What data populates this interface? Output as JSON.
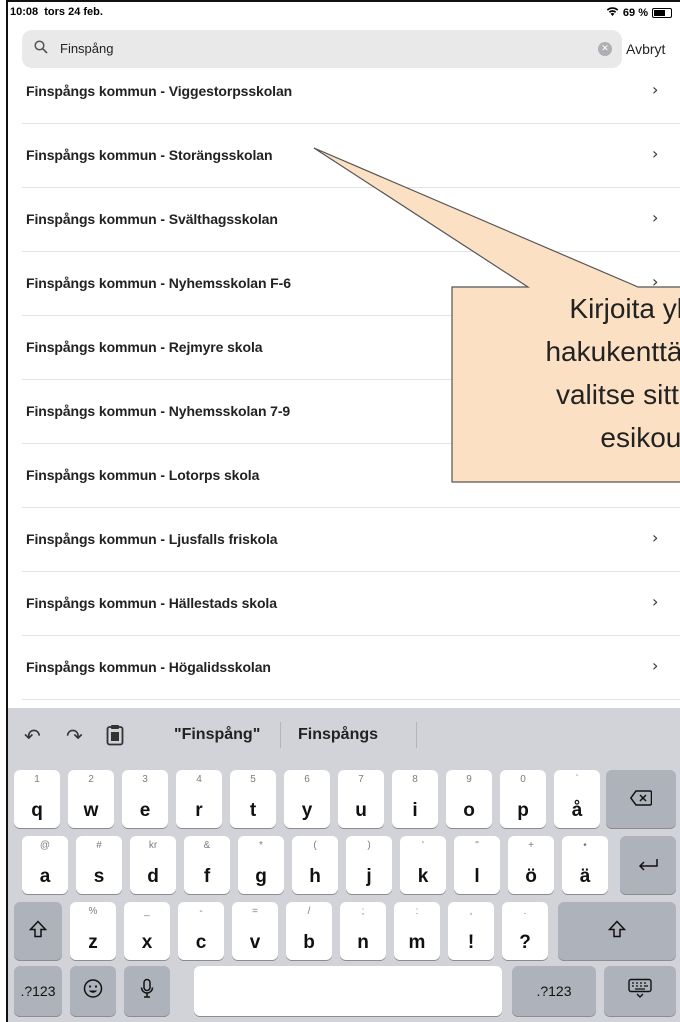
{
  "status": {
    "time": "10:08",
    "date": "tors 24 feb.",
    "battery": "69 %",
    "battery_level": 0.69
  },
  "search": {
    "value": "Finspång",
    "cancel_label": "Avbryt"
  },
  "results": [
    "Finspångs kommun - Viggestorpsskolan",
    "Finspångs kommun - Storängsskolan",
    "Finspångs kommun - Svälthagsskolan",
    "Finspångs kommun - Nyhemsskolan F-6",
    "Finspångs kommun - Rejmyre skola",
    "Finspångs kommun - Nyhemsskolan 7-9",
    "Finspångs kommun - Lotorps skola",
    "Finspångs kommun - Ljusfalls friskola",
    "Finspångs kommun - Hällestads skola",
    "Finspångs kommun - Högalidsskolan"
  ],
  "callout": {
    "lines": [
      "Kirjoita ylä",
      "hakukenttään F",
      "valitse sitten l",
      "esikoul"
    ],
    "fill_color": "#fce0c4",
    "border_color": "#555555"
  },
  "keyboard": {
    "suggestions": [
      "\"Finspång\"",
      "Finspångs"
    ],
    "rows": [
      [
        {
          "main": "q",
          "alt": "1"
        },
        {
          "main": "w",
          "alt": "2"
        },
        {
          "main": "e",
          "alt": "3"
        },
        {
          "main": "r",
          "alt": "4"
        },
        {
          "main": "t",
          "alt": "5"
        },
        {
          "main": "y",
          "alt": "6"
        },
        {
          "main": "u",
          "alt": "7"
        },
        {
          "main": "i",
          "alt": "8"
        },
        {
          "main": "o",
          "alt": "9"
        },
        {
          "main": "p",
          "alt": "0"
        },
        {
          "main": "å",
          "alt": "`"
        }
      ],
      [
        {
          "main": "a",
          "alt": "@"
        },
        {
          "main": "s",
          "alt": "#"
        },
        {
          "main": "d",
          "alt": "kr"
        },
        {
          "main": "f",
          "alt": "&"
        },
        {
          "main": "g",
          "alt": "*"
        },
        {
          "main": "h",
          "alt": "("
        },
        {
          "main": "j",
          "alt": ")"
        },
        {
          "main": "k",
          "alt": "'"
        },
        {
          "main": "l",
          "alt": "\""
        },
        {
          "main": "ö",
          "alt": "+"
        },
        {
          "main": "ä",
          "alt": "•"
        }
      ],
      [
        {
          "main": "z",
          "alt": "%"
        },
        {
          "main": "x",
          "alt": "_"
        },
        {
          "main": "c",
          "alt": "-"
        },
        {
          "main": "v",
          "alt": "="
        },
        {
          "main": "b",
          "alt": "/"
        },
        {
          "main": "n",
          "alt": ";"
        },
        {
          "main": "m",
          "alt": ":"
        },
        {
          "main": "!",
          "alt": ","
        },
        {
          "main": "?",
          "alt": "."
        }
      ]
    ],
    "numbers_label": ".?123"
  }
}
